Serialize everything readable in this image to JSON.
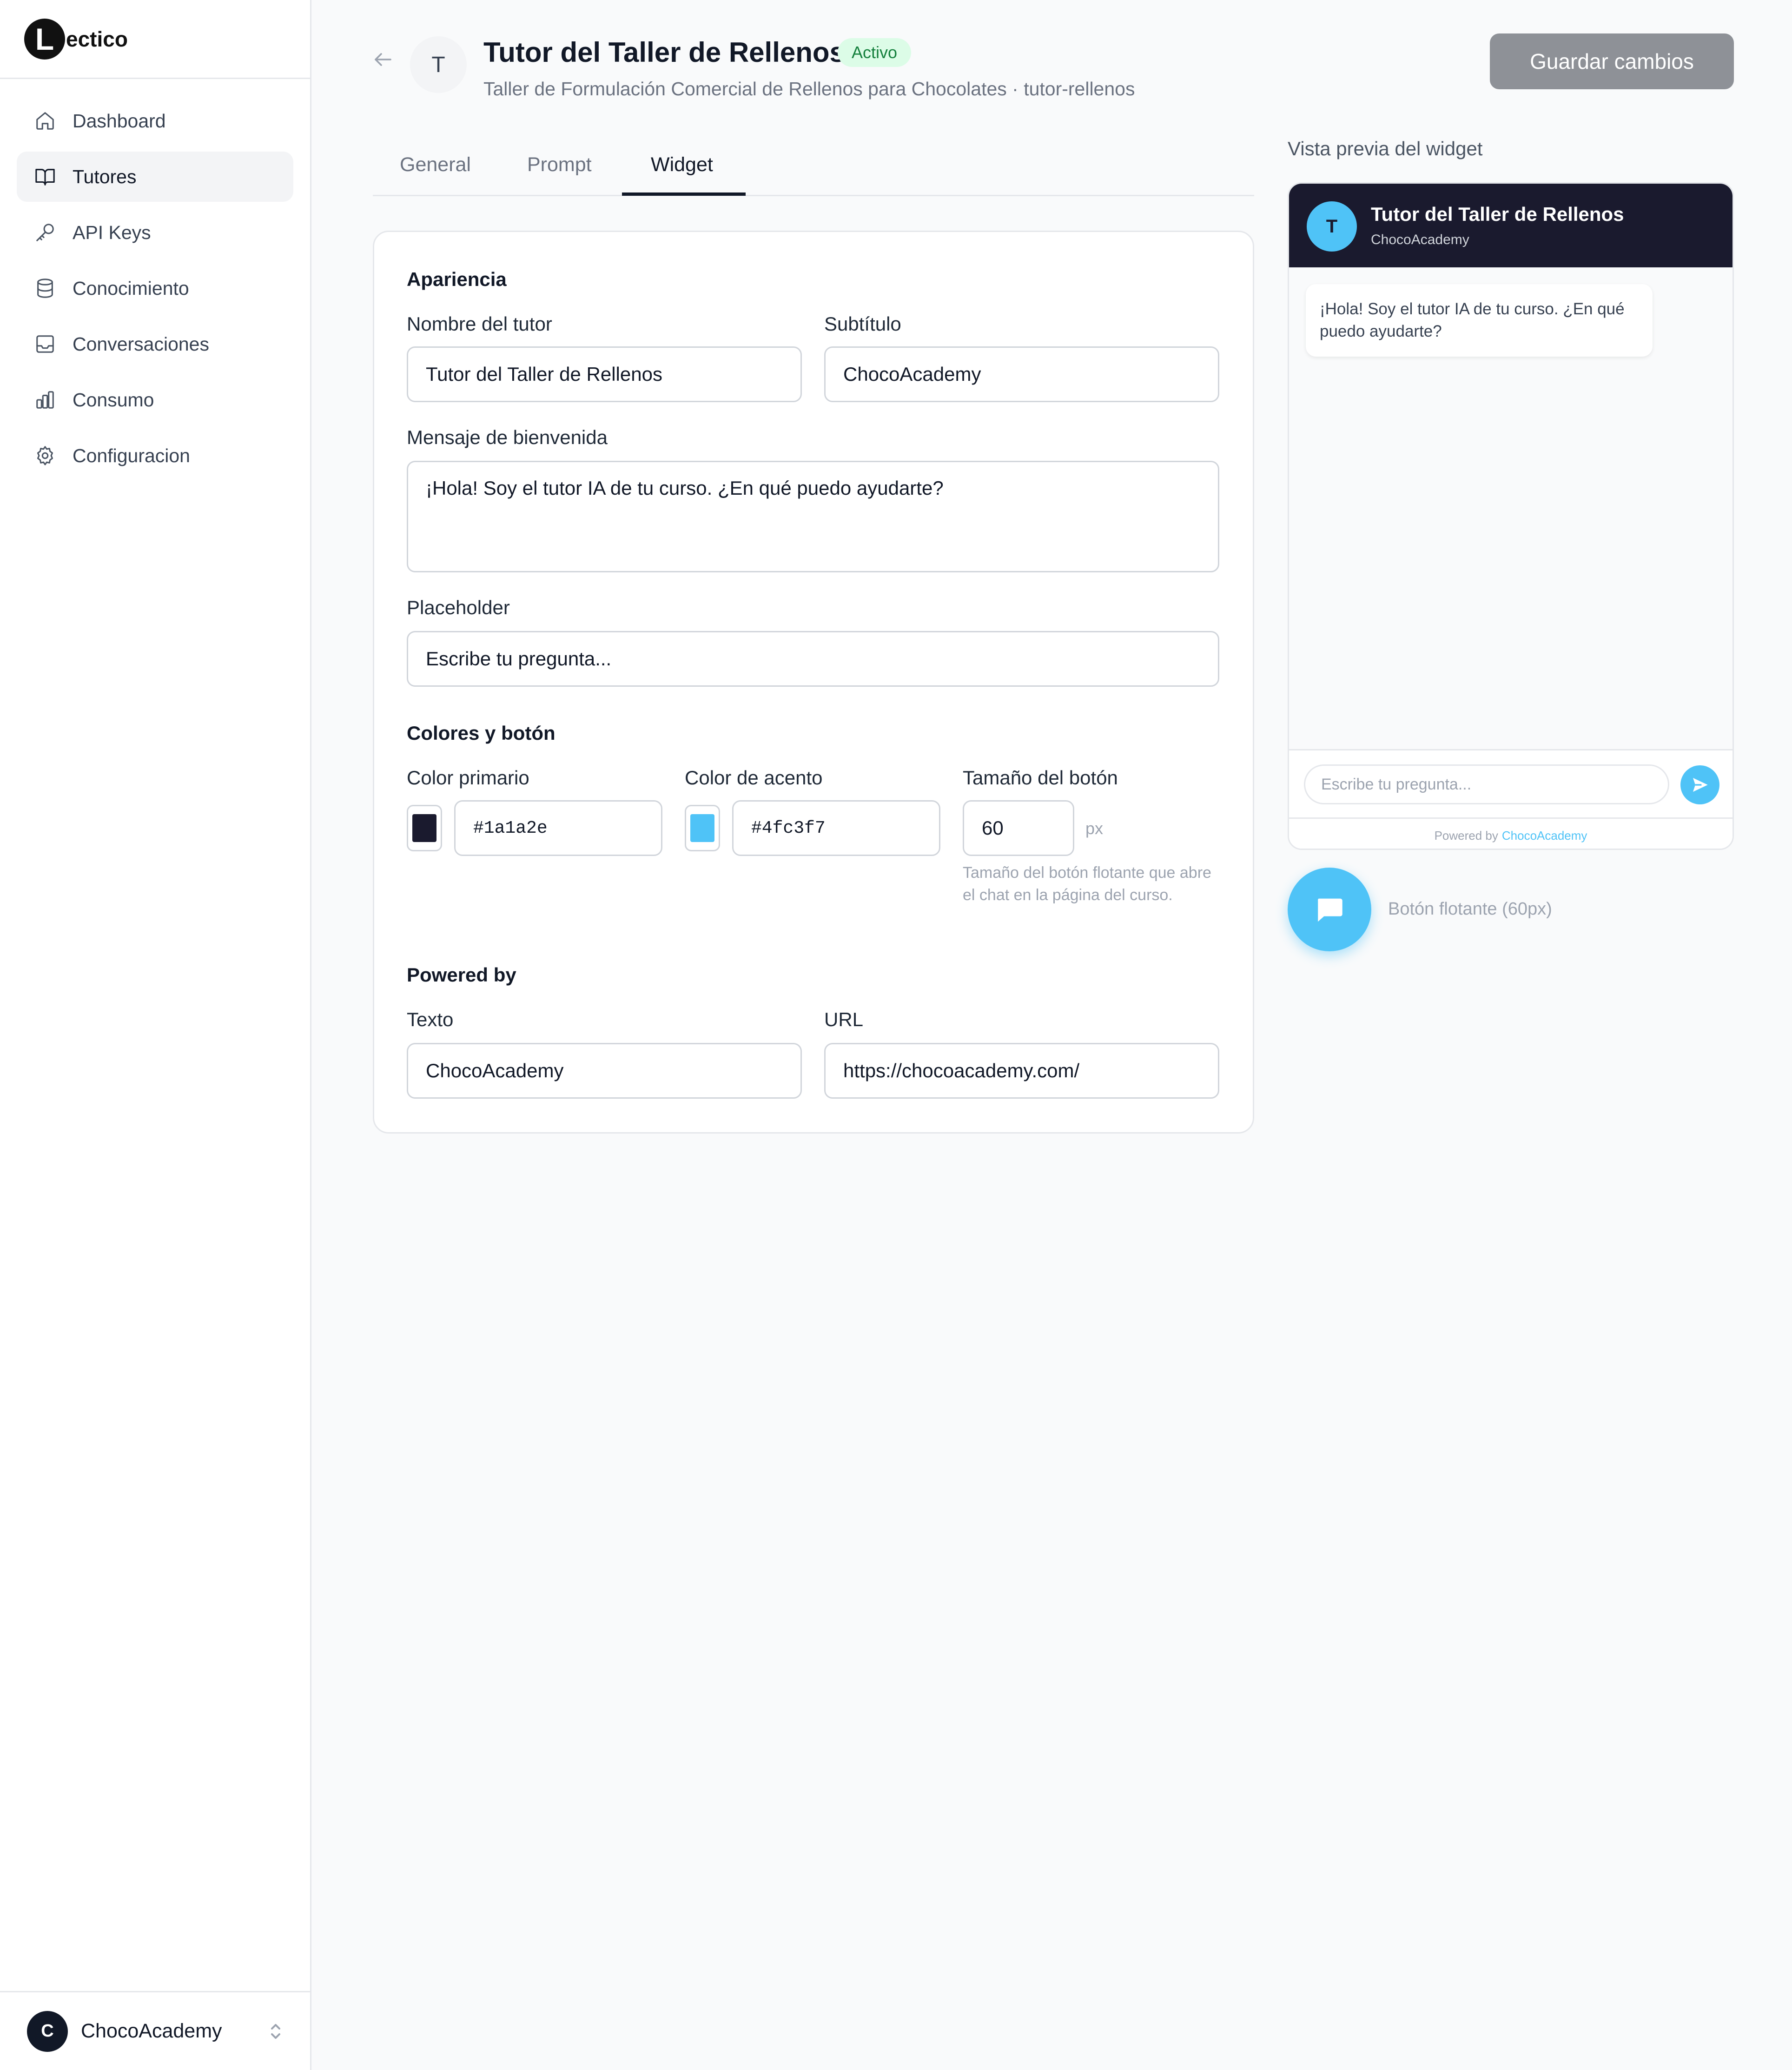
{
  "brand": {
    "logo_letter": "L",
    "name": "ectico"
  },
  "sidebar": {
    "items": [
      {
        "label": "Dashboard",
        "icon": "home-icon"
      },
      {
        "label": "Tutores",
        "icon": "book-icon",
        "active": true
      },
      {
        "label": "API Keys",
        "icon": "key-icon"
      },
      {
        "label": "Conocimiento",
        "icon": "database-icon"
      },
      {
        "label": "Conversaciones",
        "icon": "inbox-icon"
      },
      {
        "label": "Consumo",
        "icon": "bar-chart-icon"
      },
      {
        "label": "Configuracion",
        "icon": "gear-icon"
      }
    ],
    "org": {
      "avatar_letter": "C",
      "name": "ChocoAcademy"
    }
  },
  "header": {
    "avatar_letter": "T",
    "title": "Tutor del Taller de Rellenos",
    "status": "Activo",
    "subtitle": "Taller de Formulación Comercial de Rellenos para Chocolates · tutor-rellenos",
    "save_label": "Guardar cambios"
  },
  "tabs": [
    {
      "label": "General"
    },
    {
      "label": "Prompt"
    },
    {
      "label": "Widget",
      "active": true
    }
  ],
  "form": {
    "appearance": {
      "title": "Apariencia",
      "tutor_name_label": "Nombre del tutor",
      "tutor_name_value": "Tutor del Taller de Rellenos",
      "subtitle_label": "Subtítulo",
      "subtitle_value": "ChocoAcademy",
      "welcome_label": "Mensaje de bienvenida",
      "welcome_value": "¡Hola! Soy el tutor IA de tu curso. ¿En qué puedo ayudarte?",
      "placeholder_label": "Placeholder",
      "placeholder_value": "Escribe tu pregunta..."
    },
    "colors": {
      "title": "Colores y botón",
      "primary_label": "Color primario",
      "primary_value": "#1a1a2e",
      "accent_label": "Color de acento",
      "accent_value": "#4fc3f7",
      "button_size_label": "Tamaño del botón",
      "button_size_value": "60",
      "button_size_unit": "px",
      "button_size_help": "Tamaño del botón flotante que abre el chat en la página del curso."
    },
    "powered_by": {
      "title": "Powered by",
      "text_label": "Texto",
      "text_value": "ChocoAcademy",
      "url_label": "URL",
      "url_value": "https://chocoacademy.com/"
    }
  },
  "preview": {
    "label": "Vista previa del widget",
    "avatar_letter": "T",
    "title": "Tutor del Taller de Rellenos",
    "subtitle": "ChocoAcademy",
    "welcome": "¡Hola! Soy el tutor IA de tu curso. ¿En qué puedo ayudarte?",
    "input_placeholder": "Escribe tu pregunta...",
    "powered_prefix": "Powered by",
    "powered_name": "ChocoAcademy",
    "float_label": "Botón flotante (60px)"
  },
  "colors": {
    "primary": "#1a1a2e",
    "accent": "#4fc3f7",
    "status_bg": "#dcfce7",
    "status_fg": "#15803d"
  }
}
